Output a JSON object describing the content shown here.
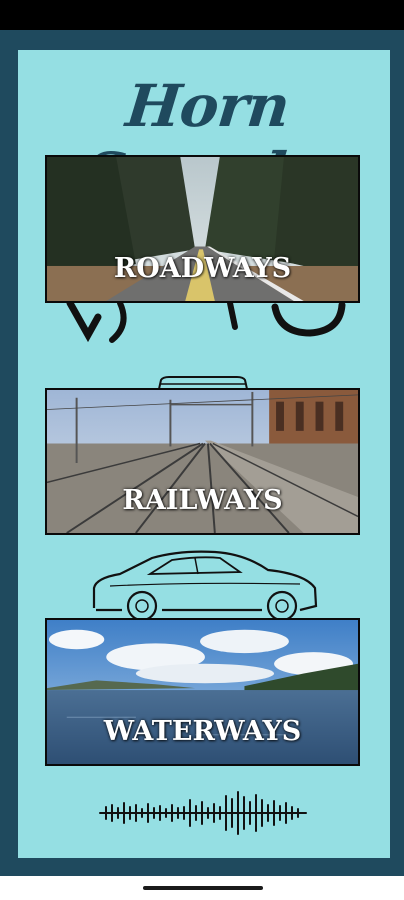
{
  "app": {
    "title": "Horn Sounds"
  },
  "categories": [
    {
      "id": "roadways",
      "label": "ROADWAYS",
      "icon": "truck-icon"
    },
    {
      "id": "railways",
      "label": "RAILWAYS",
      "icon": "train-icon"
    },
    {
      "id": "waterways",
      "label": "WATERWAYS",
      "icon": "car-icon"
    }
  ],
  "decor": {
    "waveform": "sound-wave-icon"
  },
  "colors": {
    "frame": "#1f4a5e",
    "panel": "#95dfe3",
    "title": "#1f4a5e",
    "label": "#ffffff",
    "border": "#0a0a0a"
  }
}
